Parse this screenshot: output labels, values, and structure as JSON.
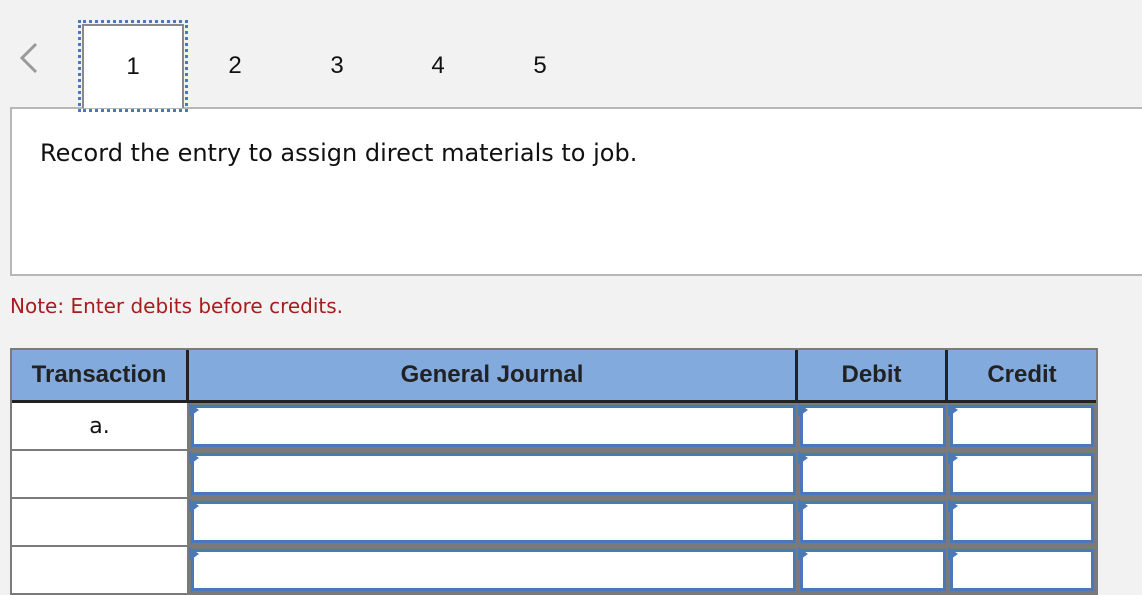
{
  "navigation": {
    "prev_icon": "chevron-left-icon",
    "tabs": [
      {
        "label": "1",
        "active": true
      },
      {
        "label": "2",
        "active": false
      },
      {
        "label": "3",
        "active": false
      },
      {
        "label": "4",
        "active": false
      },
      {
        "label": "5",
        "active": false
      }
    ]
  },
  "question": {
    "text": "Record the entry to assign direct materials to job."
  },
  "note": "Note: Enter debits before credits.",
  "colors": {
    "header_bg": "#82aadd",
    "input_border": "#4a78b8",
    "note_text": "#a51e1e"
  },
  "journal": {
    "headers": [
      "Transaction",
      "General Journal",
      "Debit",
      "Credit"
    ],
    "rows": [
      {
        "transaction": "a.",
        "account": "",
        "debit": "",
        "credit": ""
      },
      {
        "transaction": "",
        "account": "",
        "debit": "",
        "credit": ""
      },
      {
        "transaction": "",
        "account": "",
        "debit": "",
        "credit": ""
      },
      {
        "transaction": "",
        "account": "",
        "debit": "",
        "credit": ""
      }
    ]
  }
}
